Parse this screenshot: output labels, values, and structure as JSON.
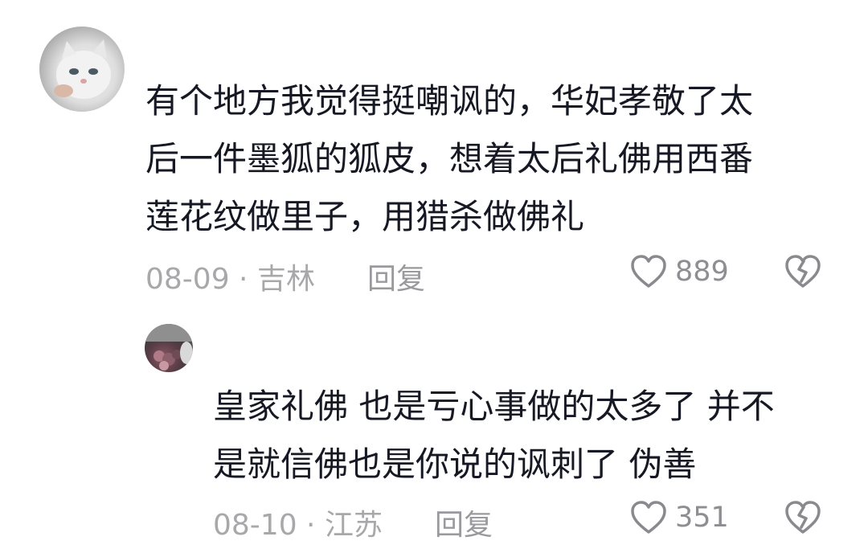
{
  "comment": {
    "text_lines": [
      "有个地方我觉得挺嘲讽的，华妃孝敬了太",
      "后一件墨狐的狐皮，想着太后礼佛用西番",
      "莲花纹做里子，用猎杀做佛礼"
    ],
    "date_location": "08-09 · 吉林",
    "reply_label": "回复",
    "like_count": "889",
    "like_icon": "heart-outline-icon",
    "dislike_icon": "broken-heart-icon"
  },
  "reply": {
    "text_lines": [
      "皇家礼佛 也是亏心事做的太多了 并不",
      "是就信佛也是你说的讽刺了 伪善"
    ],
    "date_location": "08-10 · 江苏",
    "reply_label": "回复",
    "like_count": "351",
    "like_icon": "heart-outline-icon",
    "dislike_icon": "broken-heart-icon"
  }
}
